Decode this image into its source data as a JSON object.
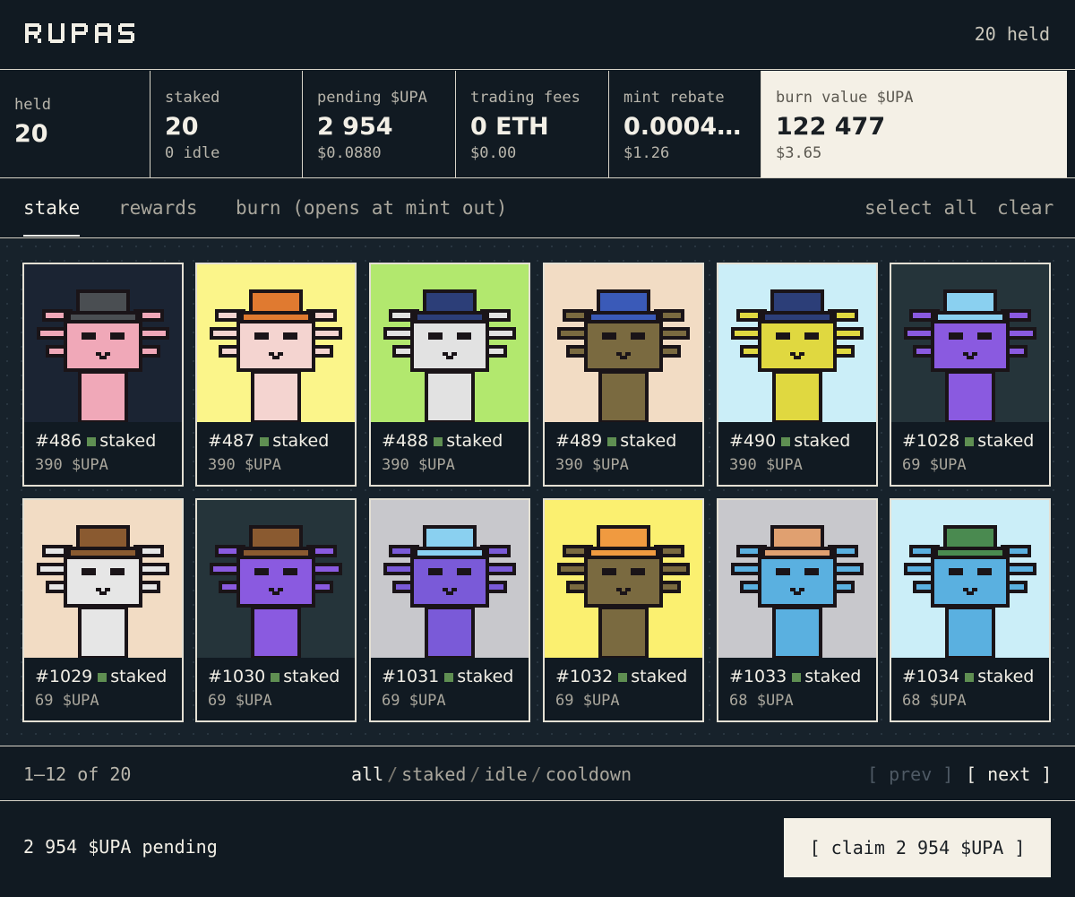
{
  "header": {
    "logo": "RUPAS",
    "held": "20 held"
  },
  "stats": [
    {
      "label": "held",
      "value": "20",
      "sub": ""
    },
    {
      "label": "staked",
      "value": "20",
      "sub": "0 idle"
    },
    {
      "label": "pending $UPA",
      "value": "2 954",
      "sub": "$0.0880"
    },
    {
      "label": "trading fees",
      "value": "0 ETH",
      "sub": "$0.00"
    },
    {
      "label": "mint rebate",
      "value": "0.0004…",
      "sub": "$1.26"
    },
    {
      "label": "burn value $UPA",
      "value": "122 477",
      "sub": "$3.65"
    }
  ],
  "tabs": {
    "stake": "stake",
    "rewards": "rewards",
    "burn": "burn (opens at mint out)"
  },
  "actions": {
    "select_all": "select all",
    "clear": "clear"
  },
  "cards": [
    {
      "id": "#486",
      "status": "staked",
      "reward": "390 $UPA",
      "bg": "#1b2433",
      "body": "#f0a8b8",
      "hat": "#4a4e52"
    },
    {
      "id": "#487",
      "status": "staked",
      "reward": "390 $UPA",
      "bg": "#fbf58a",
      "body": "#f4d4d0",
      "hat": "#e07a30"
    },
    {
      "id": "#488",
      "status": "staked",
      "reward": "390 $UPA",
      "bg": "#b2e86e",
      "body": "#e2e2e2",
      "hat": "#2c3e78"
    },
    {
      "id": "#489",
      "status": "staked",
      "reward": "390 $UPA",
      "bg": "#f2dcc4",
      "body": "#7a6a40",
      "hat": "#3a5ab8"
    },
    {
      "id": "#490",
      "status": "staked",
      "reward": "390 $UPA",
      "bg": "#cbeef8",
      "body": "#e0d840",
      "hat": "#2c3e78"
    },
    {
      "id": "#1028",
      "status": "staked",
      "reward": "69 $UPA",
      "bg": "#25343a",
      "body": "#8a5ae0",
      "hat": "#8ad0f0"
    },
    {
      "id": "#1029",
      "status": "staked",
      "reward": "69 $UPA",
      "bg": "#f2dcc4",
      "body": "#e6e6e6",
      "hat": "#8a5a30"
    },
    {
      "id": "#1030",
      "status": "staked",
      "reward": "69 $UPA",
      "bg": "#25343a",
      "body": "#8a5ae0",
      "hat": "#8a5a30"
    },
    {
      "id": "#1031",
      "status": "staked",
      "reward": "69 $UPA",
      "bg": "#c8c8cc",
      "body": "#7a5ad8",
      "hat": "#8ad0f0"
    },
    {
      "id": "#1032",
      "status": "staked",
      "reward": "69 $UPA",
      "bg": "#fbf070",
      "body": "#7a6a40",
      "hat": "#f09a40"
    },
    {
      "id": "#1033",
      "status": "staked",
      "reward": "68 $UPA",
      "bg": "#c8c8cc",
      "body": "#5ab0e0",
      "hat": "#e0a070"
    },
    {
      "id": "#1034",
      "status": "staked",
      "reward": "68 $UPA",
      "bg": "#cbeef8",
      "body": "#5ab0e0",
      "hat": "#4a8a50"
    }
  ],
  "pager": {
    "count": "1–12 of 20",
    "filters": {
      "all": "all",
      "staked": "staked",
      "idle": "idle",
      "cooldown": "cooldown"
    },
    "separator": "/",
    "prev": "[ prev ]",
    "next": "[ next ]"
  },
  "footer": {
    "pending": "2 954 $UPA pending",
    "claim": "[ claim 2 954 $UPA ]"
  },
  "colors": {
    "background": "#111a22",
    "accent": "#f4f0e6",
    "staked_dot": "#5f8f52"
  }
}
